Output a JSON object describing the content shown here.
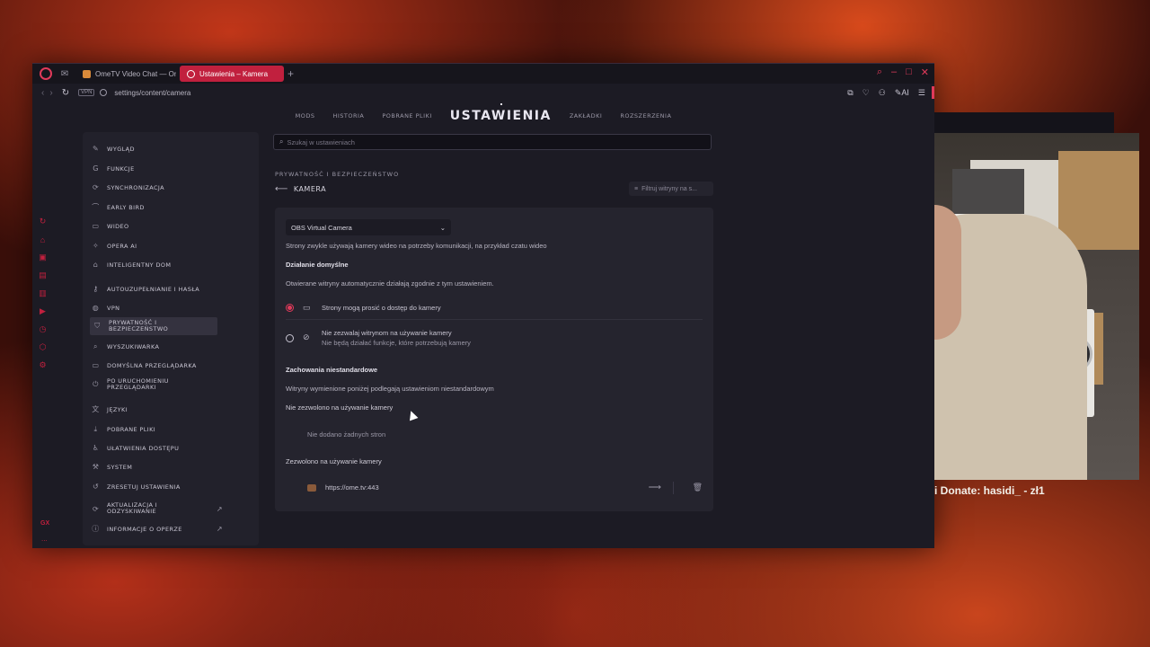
{
  "browser": {
    "tabs": [
      {
        "label": "OmeTV Video Chat — Ome",
        "active": false
      },
      {
        "label": "Ustawienia – Kamera",
        "active": true
      }
    ],
    "url": "settings/content/camera",
    "vpn_label": "VPN",
    "ai_label": "AI"
  },
  "sidebar_icons": [
    "refresh-icon",
    "shopping-icon",
    "twitch-like-icon",
    "discord-icon",
    "twitch-icon",
    "player-icon",
    "history-icon",
    "extensions-icon",
    "settings-icon"
  ],
  "sidebar_bottom": {
    "gx_label": "GX",
    "more_label": "..."
  },
  "settings_nav": {
    "items_left": [
      "MODS",
      "HISTORIA",
      "POBRANE PLIKI"
    ],
    "title": "USTAWIENIA",
    "items_right": [
      "ZAKŁADKI",
      "ROZSZERZENIA"
    ]
  },
  "search": {
    "placeholder": "Szukaj w ustawieniach"
  },
  "menu": {
    "items": [
      {
        "label": "WYGLĄD",
        "icon": "brush-icon"
      },
      {
        "label": "FUNKCJE",
        "icon": "gx-icon"
      },
      {
        "label": "SYNCHRONIZACJA",
        "icon": "sync-icon"
      },
      {
        "label": "EARLY BIRD",
        "icon": "bird-icon"
      },
      {
        "label": "WIDEO",
        "icon": "video-icon"
      },
      {
        "label": "OPERA AI",
        "icon": "ai-icon"
      },
      {
        "label": "INTELIGENTNY DOM",
        "icon": "home-icon"
      },
      {
        "label": "AUTOUZUPEŁNIANIE I HASŁA",
        "icon": "key-icon"
      },
      {
        "label": "VPN",
        "icon": "globe-icon"
      },
      {
        "label": "PRYWATNOŚĆ I BEZPIECZEŃSTWO",
        "icon": "shield-icon"
      },
      {
        "label": "WYSZUKIWARKA",
        "icon": "search-icon"
      },
      {
        "label": "DOMYŚLNA PRZEGLĄDARKA",
        "icon": "browser-icon"
      },
      {
        "label": "PO URUCHOMIENIU PRZEGLĄDARKI",
        "icon": "power-icon"
      },
      {
        "label": "JĘZYKI",
        "icon": "language-icon"
      },
      {
        "label": "POBRANE PLIKI",
        "icon": "download-icon"
      },
      {
        "label": "UŁATWIENIA DOSTĘPU",
        "icon": "accessibility-icon"
      },
      {
        "label": "SYSTEM",
        "icon": "wrench-icon"
      },
      {
        "label": "ZRESETUJ USTAWIENIA",
        "icon": "reset-icon"
      },
      {
        "label": "AKTUALIZACJA I ODZYSKIWANIE",
        "icon": "update-icon"
      },
      {
        "label": "INFORMACJE O OPERZE",
        "icon": "info-icon"
      }
    ]
  },
  "content": {
    "breadcrumb": "PRYWATNOŚĆ I BEZPIECZEŃSTWO",
    "page_title": "KAMERA",
    "filter_placeholder": "Filtruj witryny na s...",
    "camera_select": "OBS Virtual Camera",
    "desc": "Strony zwykle używają kamery wideo na potrzeby komunikacji, na przykład czatu wideo",
    "default_heading": "Działanie domyślne",
    "default_desc": "Otwierane witryny automatycznie działają zgodnie z tym ustawieniem.",
    "option_allow": "Strony mogą prosić o dostęp do kamery",
    "option_block": "Nie zezwalaj witrynom na używanie kamery",
    "option_block_sub": "Nie będą działać funkcje, które potrzebują kamery",
    "custom_heading": "Zachowania niestandardowe",
    "custom_desc": "Witryny wymienione poniżej podlegają ustawieniom niestandardowym",
    "blocked_heading": "Nie zezwolono na używanie kamery",
    "blocked_empty": "Nie dodano żadnych stron",
    "allowed_heading": "Zezwolono na używanie kamery",
    "allowed_site": "https://ome.tv:443"
  },
  "overlay": {
    "donate_text": "i Donate: hasidi_ - zł1"
  },
  "colors": {
    "accent": "#e03a5a",
    "tab_active": "#c1203e",
    "panel": "#25242e",
    "bg": "#1c1b24"
  }
}
